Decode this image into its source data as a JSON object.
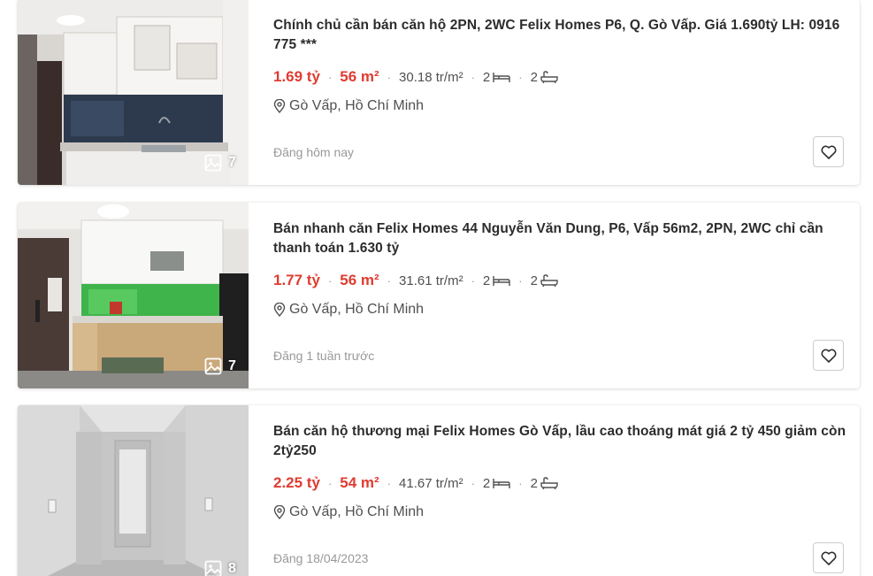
{
  "listings": [
    {
      "title": "Chính chủ cần bán căn hộ 2PN, 2WC Felix Homes P6, Q. Gò Vấp. Giá 1.690tỷ LH: 0916 775 ***",
      "price": "1.69 tỷ",
      "area": "56 m²",
      "price_per_m2": "30.18 tr/m²",
      "bedrooms": "2",
      "bathrooms": "2",
      "location": "Gò Vấp, Hồ Chí Minh",
      "posted": "Đăng hôm nay",
      "photo_count": "7"
    },
    {
      "title": "Bán nhanh căn Felix Homes 44 Nguyễn Văn Dung, P6, Vấp 56m2, 2PN, 2WC chỉ cần thanh toán 1.630 tỷ",
      "price": "1.77 tỷ",
      "area": "56 m²",
      "price_per_m2": "31.61 tr/m²",
      "bedrooms": "2",
      "bathrooms": "2",
      "location": "Gò Vấp, Hồ Chí Minh",
      "posted": "Đăng 1 tuần trước",
      "photo_count": "7"
    },
    {
      "title": "Bán căn hộ thương mại Felix Homes Gò Vấp, lầu cao thoáng mát giá 2 tỷ 450 giảm còn 2tỷ250",
      "price": "2.25 tỷ",
      "area": "54 m²",
      "price_per_m2": "41.67 tr/m²",
      "bedrooms": "2",
      "bathrooms": "2",
      "location": "Gò Vấp, Hồ Chí Minh",
      "posted": "Đăng 18/04/2023",
      "photo_count": "8"
    }
  ],
  "icons": {
    "photos": "image-gallery-icon",
    "bed": "bed-icon",
    "bath": "bathtub-icon",
    "location": "location-pin-icon",
    "favorite": "heart-outline-icon"
  },
  "colors": {
    "price": "#e03c31",
    "muted": "#999999",
    "text": "#2c2c2c"
  }
}
